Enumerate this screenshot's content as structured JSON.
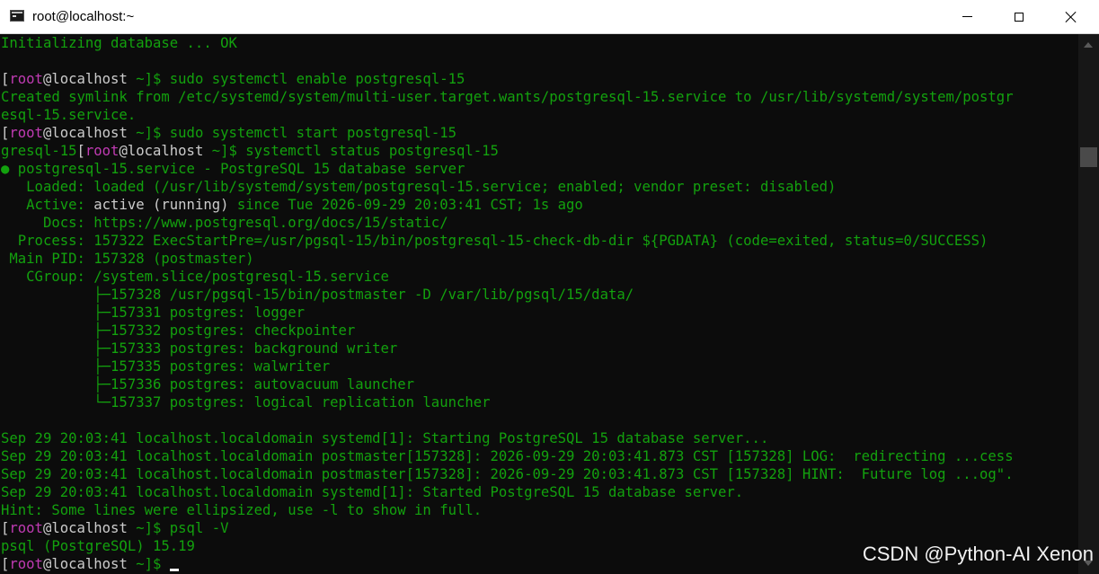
{
  "window": {
    "title": "root@localhost:~",
    "icon": "terminal-icon"
  },
  "terminal_lines": [
    [
      {
        "t": "Initializing database ... OK",
        "c": "g"
      }
    ],
    [],
    [
      {
        "t": "[",
        "c": "w"
      },
      {
        "t": "root",
        "c": "m"
      },
      {
        "t": "@",
        "c": "w"
      },
      {
        "t": "localhost",
        "c": "w"
      },
      {
        "t": " ~]$ sudo systemctl enable postgresql-15",
        "c": "g"
      }
    ],
    [
      {
        "t": "Created symlink from /etc/systemd/system/multi-user.target.wants/postgresql-15.service to /usr/lib/systemd/system/postgr",
        "c": "g"
      }
    ],
    [
      {
        "t": "esql-15.service.",
        "c": "g"
      }
    ],
    [
      {
        "t": "[",
        "c": "w"
      },
      {
        "t": "root",
        "c": "m"
      },
      {
        "t": "@",
        "c": "w"
      },
      {
        "t": "localhost",
        "c": "w"
      },
      {
        "t": " ~]$ sudo systemctl start postgresql-15",
        "c": "g"
      }
    ],
    [
      {
        "t": "gresql-15",
        "c": "g"
      },
      {
        "t": "[",
        "c": "w"
      },
      {
        "t": "root",
        "c": "m"
      },
      {
        "t": "@",
        "c": "w"
      },
      {
        "t": "localhost",
        "c": "w"
      },
      {
        "t": " ~]$ systemctl status postgresql-15",
        "c": "g"
      }
    ],
    [
      {
        "t": "●",
        "c": "g"
      },
      {
        "t": " postgresql-15.service - PostgreSQL 15 database server",
        "c": "g"
      }
    ],
    [
      {
        "t": "   Loaded: loaded (/usr/lib/systemd/system/postgresql-15.service; enabled; vendor preset: disabled)",
        "c": "g"
      }
    ],
    [
      {
        "t": "   Active: ",
        "c": "g"
      },
      {
        "t": "active (running)",
        "c": "w"
      },
      {
        "t": " since Tue 2026-09-29 20:03:41 CST; 1s ago",
        "c": "g"
      }
    ],
    [
      {
        "t": "     Docs: https://www.postgresql.org/docs/15/static/",
        "c": "g"
      }
    ],
    [
      {
        "t": "  Process: 157322 ExecStartPre=/usr/pgsql-15/bin/postgresql-15-check-db-dir ${PGDATA} (code=exited, status=0/SUCCESS)",
        "c": "g"
      }
    ],
    [
      {
        "t": " Main PID: 157328 (postmaster)",
        "c": "g"
      }
    ],
    [
      {
        "t": "   CGroup: /system.slice/postgresql-15.service",
        "c": "g"
      }
    ],
    [
      {
        "t": "           ├─157328 /usr/pgsql-15/bin/postmaster -D /var/lib/pgsql/15/data/",
        "c": "g"
      }
    ],
    [
      {
        "t": "           ├─157331 postgres: logger",
        "c": "g"
      }
    ],
    [
      {
        "t": "           ├─157332 postgres: checkpointer",
        "c": "g"
      }
    ],
    [
      {
        "t": "           ├─157333 postgres: background writer",
        "c": "g"
      }
    ],
    [
      {
        "t": "           ├─157335 postgres: walwriter",
        "c": "g"
      }
    ],
    [
      {
        "t": "           ├─157336 postgres: autovacuum launcher",
        "c": "g"
      }
    ],
    [
      {
        "t": "           └─157337 postgres: logical replication launcher",
        "c": "g"
      }
    ],
    [],
    [
      {
        "t": "Sep 29 20:03:41 localhost.localdomain systemd[1]: Starting PostgreSQL 15 database server...",
        "c": "g"
      }
    ],
    [
      {
        "t": "Sep 29 20:03:41 localhost.localdomain postmaster[157328]: 2026-09-29 20:03:41.873 CST [157328] LOG:  redirecting ...cess",
        "c": "g"
      }
    ],
    [
      {
        "t": "Sep 29 20:03:41 localhost.localdomain postmaster[157328]: 2026-09-29 20:03:41.873 CST [157328] HINT:  Future log ...og\".",
        "c": "g"
      }
    ],
    [
      {
        "t": "Sep 29 20:03:41 localhost.localdomain systemd[1]: Started PostgreSQL 15 database server.",
        "c": "g"
      }
    ],
    [
      {
        "t": "Hint: Some lines were ellipsized, use -l to show in full.",
        "c": "g"
      }
    ],
    [
      {
        "t": "[",
        "c": "w"
      },
      {
        "t": "root",
        "c": "m"
      },
      {
        "t": "@",
        "c": "w"
      },
      {
        "t": "localhost",
        "c": "w"
      },
      {
        "t": " ~]$ psql -V",
        "c": "g"
      }
    ],
    [
      {
        "t": "psql (PostgreSQL) 15.19",
        "c": "g"
      }
    ],
    [
      {
        "t": "[",
        "c": "w"
      },
      {
        "t": "root",
        "c": "m"
      },
      {
        "t": "@",
        "c": "w"
      },
      {
        "t": "localhost",
        "c": "w"
      },
      {
        "t": " ~]$ ",
        "c": "g"
      }
    ]
  ],
  "watermark": "CSDN @Python-AI Xenon",
  "colors": {
    "background": "#0c0c0c",
    "green": "#13a10e",
    "white": "#cccccc",
    "magenta": "#c03bb3"
  }
}
